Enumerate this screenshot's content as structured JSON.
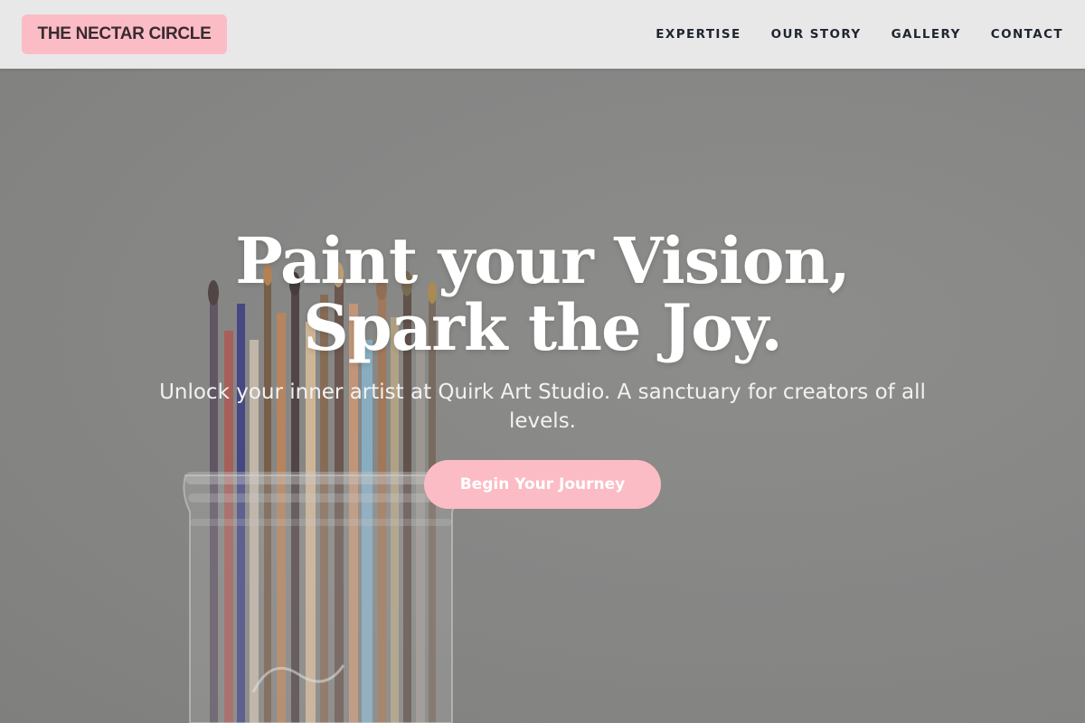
{
  "header": {
    "logo": "THE NECTAR CIRCLE",
    "nav": [
      {
        "label": "EXPERTISE"
      },
      {
        "label": "OUR STORY"
      },
      {
        "label": "GALLERY"
      },
      {
        "label": "CONTACT"
      }
    ]
  },
  "hero": {
    "title": "Paint your Vision, Spark the Joy.",
    "subtitle": "Unlock your inner artist at Quirk Art Studio. A sanctuary for creators of all levels.",
    "cta_label": "Begin Your Journey",
    "background_image": "paintbrushes-in-glass-jar"
  },
  "colors": {
    "accent": "#fbbcc6",
    "header_bg": "#e8e8e8",
    "nav_text": "#1f2430",
    "hero_bg": "#8e8e8c"
  }
}
